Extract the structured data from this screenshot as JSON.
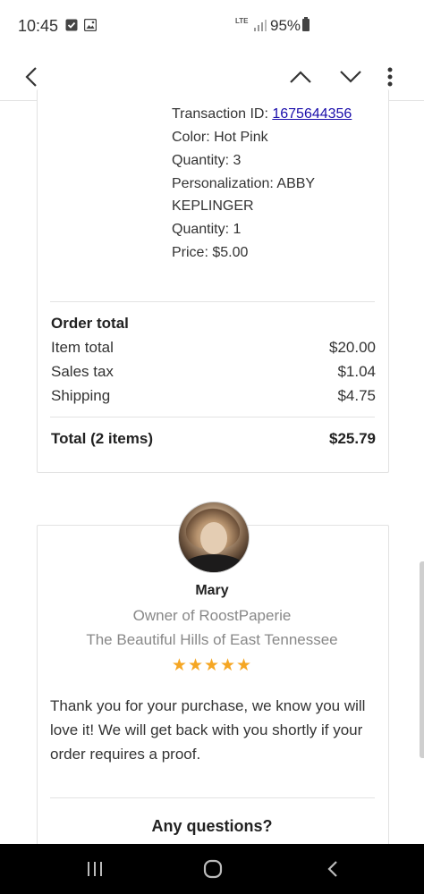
{
  "status_bar": {
    "time": "10:45",
    "network": "LTE",
    "battery": "95%"
  },
  "toolbar": {
    "back_icon": "back-arrow-icon",
    "prev_icon": "chevron-up-icon",
    "next_icon": "chevron-down-icon",
    "more_icon": "more-vert-icon"
  },
  "order_item": {
    "transaction_label": "Transaction ID: ",
    "transaction_id": "1675644356",
    "color": "Color: Hot Pink",
    "quantity_a": "Quantity: 3",
    "personalization_1": "Personalization: ABBY",
    "personalization_2": "KEPLINGER",
    "quantity_b": "Quantity: 1",
    "price": "Price: $5.00"
  },
  "order_total": {
    "heading": "Order total",
    "rows": [
      {
        "label": "Item total",
        "value": "$20.00"
      },
      {
        "label": "Sales tax",
        "value": "$1.04"
      },
      {
        "label": "Shipping",
        "value": "$4.75"
      }
    ],
    "total_label": "Total (2 items)",
    "total_value": "$25.79"
  },
  "seller": {
    "name": "Mary",
    "role": "Owner of RoostPaperie",
    "location": "The Beautiful Hills of East Tennessee",
    "stars": "★★★★★",
    "rating": 5,
    "message": "Thank you for your purchase, we know you will love it! We will get back with you shortly if your order requires a proof.",
    "questions_heading": "Any questions?"
  },
  "colors": {
    "link": "#1a0dab",
    "star": "#f5a623",
    "muted_text": "#888888"
  }
}
